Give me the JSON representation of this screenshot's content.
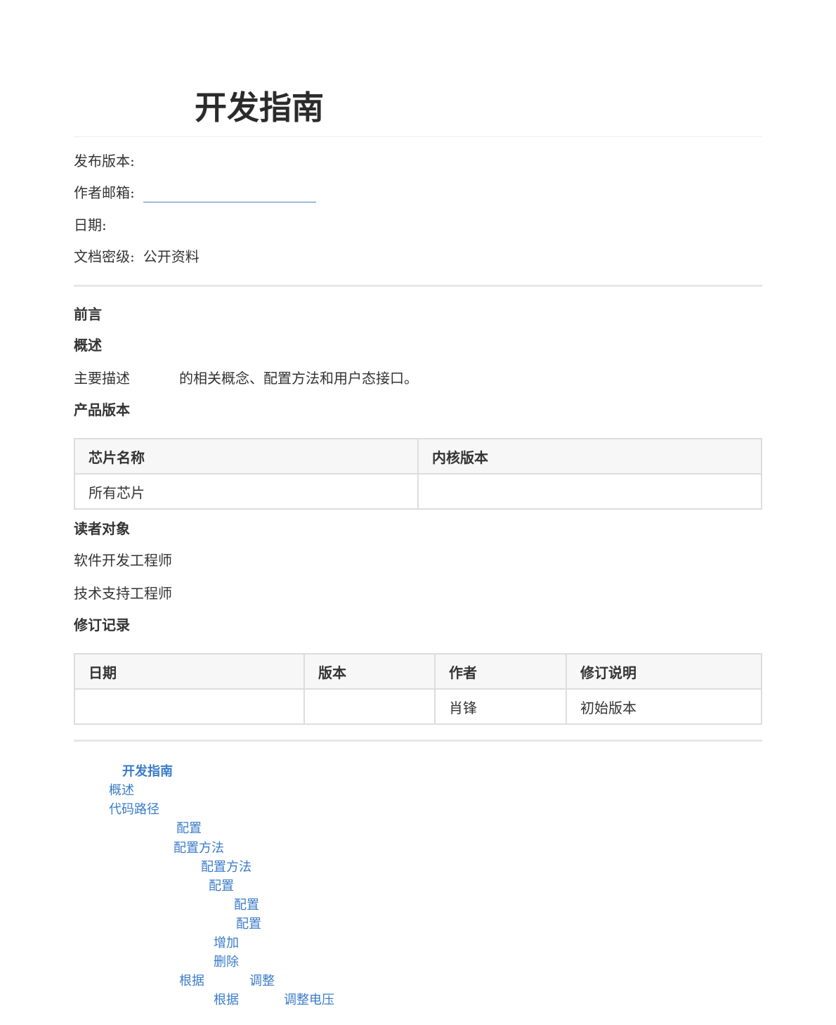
{
  "title": "开发指南",
  "meta": {
    "release_label": "发布版本:",
    "release_value": "",
    "email_label": "作者邮箱:",
    "email_value": "",
    "date_label": "日期:",
    "date_value": "",
    "security_label": "文档密级:",
    "security_value": "公开资料"
  },
  "sections": {
    "preface": "前言",
    "overview": "概述",
    "overview_text_a": "主要描述",
    "overview_text_b": "的相关概念、配置方法和用户态接口。",
    "product_version": "产品版本",
    "readers": "读者对象",
    "reader_1": "软件开发工程师",
    "reader_2": "技术支持工程师",
    "revision": "修订记录"
  },
  "product_table": {
    "headers": [
      "芯片名称",
      "内核版本"
    ],
    "rows": [
      [
        "所有芯片",
        ""
      ]
    ]
  },
  "revision_table": {
    "headers": [
      "日期",
      "版本",
      "作者",
      "修订说明"
    ],
    "rows": [
      [
        "",
        "",
        "肖锋",
        "初始版本"
      ]
    ]
  },
  "toc": [
    {
      "label": "开发指南"
    },
    {
      "label": "概述"
    },
    {
      "label": "代码路径"
    },
    {
      "label": "配置"
    },
    {
      "label": "配置方法"
    },
    {
      "label": "配置方法"
    },
    {
      "label": "配置"
    },
    {
      "label": "配置"
    },
    {
      "label": "配置"
    },
    {
      "label": "增加"
    },
    {
      "label": "删除"
    },
    {
      "label": "根据",
      "label_b": "调整"
    },
    {
      "label": "根据",
      "label_b": "调整电压"
    }
  ],
  "colors": {
    "link": "#3a7bc8",
    "text": "#333333",
    "table_header_bg": "#f7f7f7",
    "border": "#dddddd"
  }
}
